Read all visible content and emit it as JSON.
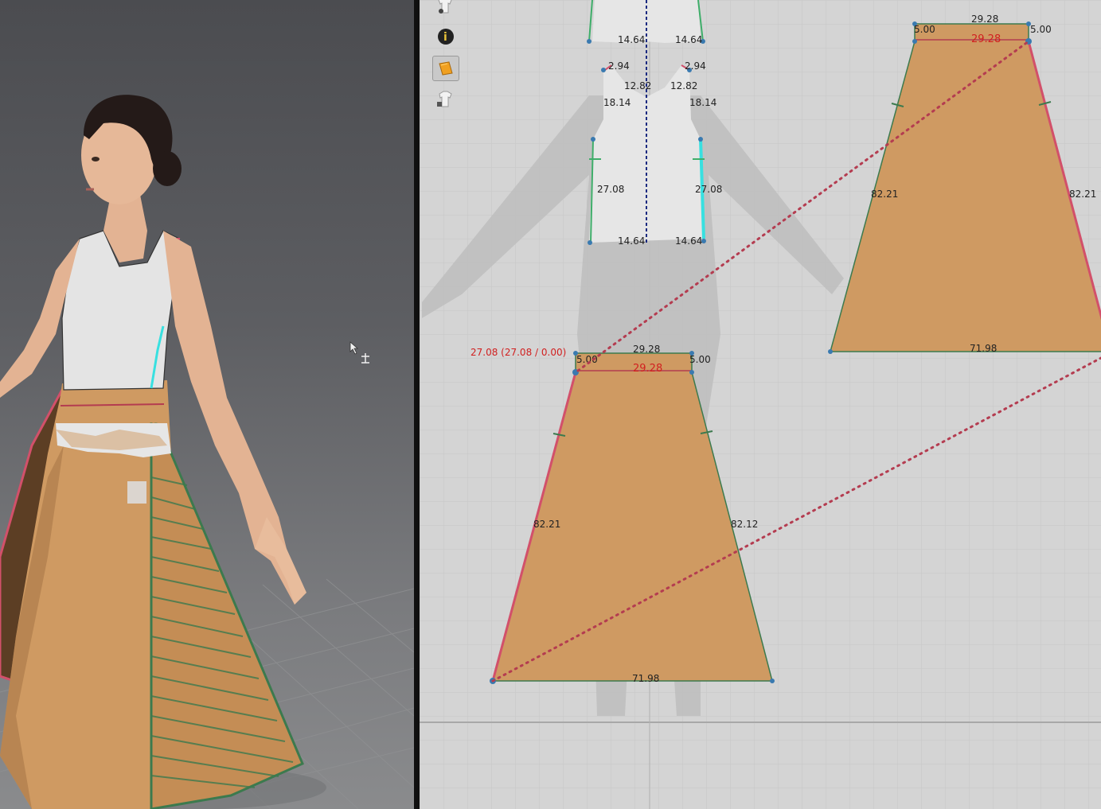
{
  "toolbar": {
    "tools": [
      {
        "name": "show-avatar-tool",
        "icon": "shirt-eye-icon"
      },
      {
        "name": "info-tool",
        "icon": "info-icon",
        "label": "i"
      },
      {
        "name": "fabric-tool",
        "icon": "fabric-swatch-icon"
      },
      {
        "name": "lock-garment-tool",
        "icon": "shirt-lock-icon"
      }
    ]
  },
  "bodice_labels": {
    "top_left_width": "14.64",
    "top_right_width": "14.64",
    "shoulder_left": "2.94",
    "shoulder_right": "2.94",
    "neck_left": "12.82",
    "neck_right": "12.82",
    "armhole_left": "18.14",
    "armhole_right": "18.14",
    "side_left": "27.08",
    "side_right": "27.08",
    "bottom_left_width": "14.64",
    "bottom_right_width": "14.64"
  },
  "skirt_front": {
    "top_width": "29.28",
    "seam_width": "29.28",
    "left_dart": "5.00",
    "right_dart": "5.00",
    "left_side": "82.21",
    "right_side": "82.12",
    "bottom_width": "71.98",
    "segment_readout": "27.08 (27.08 / 0.00)"
  },
  "skirt_back": {
    "top_width": "29.28",
    "seam_width": "29.28",
    "left_dart": "5.00",
    "right_dart": "5.00",
    "left_side": "82.21",
    "right_side": "82.21",
    "bottom_width": "71.98"
  },
  "colors": {
    "fabric": "#cf9a62",
    "fabric_stroke": "#3c7a4e",
    "selected_seam": "#d2506a",
    "sewing_line": "#b43c50",
    "active_seam": "#38e0e0",
    "bodice": "#e6e6e6",
    "grid": "#c4c4c4"
  }
}
